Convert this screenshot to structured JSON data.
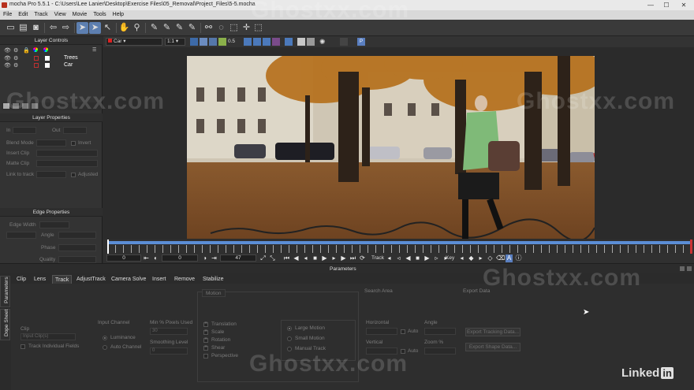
{
  "window": {
    "title": "mocha Pro 5.5.1 - C:\\Users\\Lee Lanier\\Desktop\\Exercise Files\\05_Removal\\Project_Files\\5-5.mocha",
    "minimize": "—",
    "maximize": "☐",
    "close": "✕"
  },
  "menu": [
    "File",
    "Edit",
    "Track",
    "View",
    "Movie",
    "Tools",
    "Help"
  ],
  "toolbar": {
    "icons": [
      "new-file-icon",
      "save-icon",
      "camera-icon",
      "undo-icon",
      "redo-icon",
      "select-arrow-icon",
      "select-arrow-plus-icon",
      "pick-tool-icon",
      "hand-icon",
      "zoom-icon",
      "xspline-icon",
      "bspline-icon",
      "link-icon",
      "lasso-icon",
      "transform-icon",
      "move-icon",
      "dashed-rect-icon"
    ]
  },
  "layerbar": {
    "layer_select": "Car",
    "zoom_select": "1:1",
    "opacity": "0.5",
    "p_label": "P"
  },
  "layer_controls": {
    "title": "Layer Controls",
    "layers": [
      {
        "name": "Trees",
        "color": "#c03030"
      },
      {
        "name": "Car",
        "color": "#c03030"
      }
    ]
  },
  "layer_properties": {
    "title": "Layer Properties",
    "in_label": "In",
    "out_label": "Out",
    "blend_mode": "Blend Mode",
    "invert": "Invert",
    "insert_clip": "Insert Clip",
    "matte_clip": "Matte Clip",
    "link_to_track": "Link to track",
    "adjusted": "Adjusted"
  },
  "edge_properties": {
    "title": "Edge Properties",
    "edge_width": "Edge Width",
    "angle": "Angle",
    "phase": "Phase",
    "quality": "Quality"
  },
  "transport": {
    "start_frame": "0",
    "in_frame": "0",
    "current_frame": "47",
    "track_label": "Track",
    "key_label": "Key"
  },
  "timeline": {
    "playhead_frame": 0,
    "last_frame": 99
  },
  "parameters_title": "Parameters",
  "tabs": [
    "Clip",
    "Lens",
    "Track",
    "AdjustTrack",
    "Camera Solve",
    "Insert",
    "Remove",
    "Stabilize"
  ],
  "active_tab": "Track",
  "side_tabs": [
    "Parameters",
    "Dope Sheet"
  ],
  "track_params": {
    "clip_label": "Clip",
    "clip_value": "Input Clip(s)",
    "track_individual_fields": "Track Individual Fields",
    "input_channel": "Input Channel",
    "luminance": "Luminance",
    "auto_channel": "Auto Channel",
    "min_pixels_used": "Min % Pixels Used",
    "min_pixels_value": "30",
    "smoothing_level": "Smoothing Level",
    "smoothing_value": "0",
    "motion_title": "Motion",
    "motion_items": [
      "Translation",
      "Scale",
      "Rotation",
      "Shear",
      "Perspective"
    ],
    "motion_modes": [
      "Large Motion",
      "Small Motion",
      "Manual Track"
    ],
    "search_area": "Search Area",
    "horizontal": "Horizontal",
    "vertical": "Vertical",
    "auto": "Auto",
    "angle": "Angle",
    "zoom_pct": "Zoom %",
    "export_data": "Export Data",
    "export_tracking_data": "Export Tracking Data...",
    "export_shape_data": "Export Shape Data..."
  },
  "watermarks": [
    "Ghostxx.com",
    "Ghostxx.com",
    "Ghostxx.com",
    "Ghostxx.com",
    "Ghostxx.com"
  ],
  "linkedin": {
    "text": "Linked",
    "in": "in"
  }
}
